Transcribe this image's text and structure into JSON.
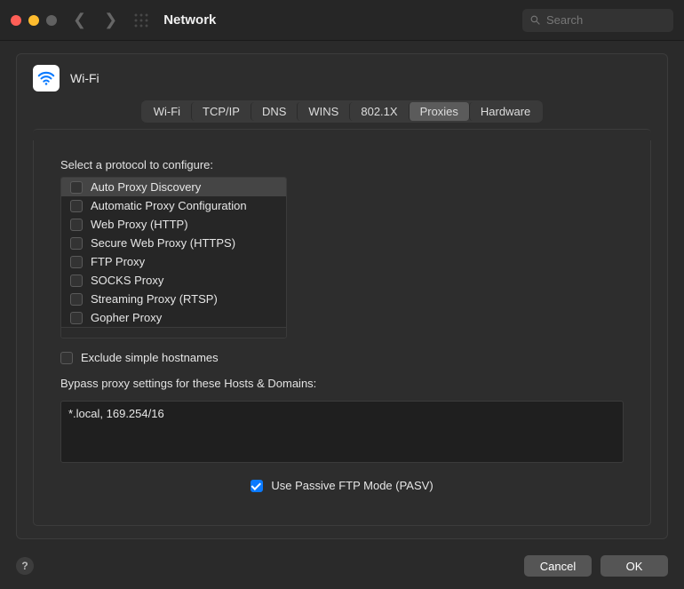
{
  "titlebar": {
    "title": "Network",
    "search_placeholder": "Search"
  },
  "header": {
    "interface_label": "Wi-Fi"
  },
  "tabs": [
    {
      "label": "Wi-Fi",
      "active": false
    },
    {
      "label": "TCP/IP",
      "active": false
    },
    {
      "label": "DNS",
      "active": false
    },
    {
      "label": "WINS",
      "active": false
    },
    {
      "label": "802.1X",
      "active": false
    },
    {
      "label": "Proxies",
      "active": true
    },
    {
      "label": "Hardware",
      "active": false
    }
  ],
  "proxies": {
    "select_label": "Select a protocol to configure:",
    "protocols": [
      {
        "label": "Auto Proxy Discovery",
        "checked": false,
        "selected": true
      },
      {
        "label": "Automatic Proxy Configuration",
        "checked": false,
        "selected": false
      },
      {
        "label": "Web Proxy (HTTP)",
        "checked": false,
        "selected": false
      },
      {
        "label": "Secure Web Proxy (HTTPS)",
        "checked": false,
        "selected": false
      },
      {
        "label": "FTP Proxy",
        "checked": false,
        "selected": false
      },
      {
        "label": "SOCKS Proxy",
        "checked": false,
        "selected": false
      },
      {
        "label": "Streaming Proxy (RTSP)",
        "checked": false,
        "selected": false
      },
      {
        "label": "Gopher Proxy",
        "checked": false,
        "selected": false
      }
    ],
    "exclude_simple_label": "Exclude simple hostnames",
    "exclude_simple_checked": false,
    "bypass_label": "Bypass proxy settings for these Hosts & Domains:",
    "bypass_value": "*.local, 169.254/16",
    "pasv_label": "Use Passive FTP Mode (PASV)",
    "pasv_checked": true
  },
  "buttons": {
    "help": "?",
    "cancel": "Cancel",
    "ok": "OK"
  },
  "colors": {
    "accent": "#0a7aff",
    "bg": "#2a2a2a",
    "panel": "#2d2d2d"
  }
}
